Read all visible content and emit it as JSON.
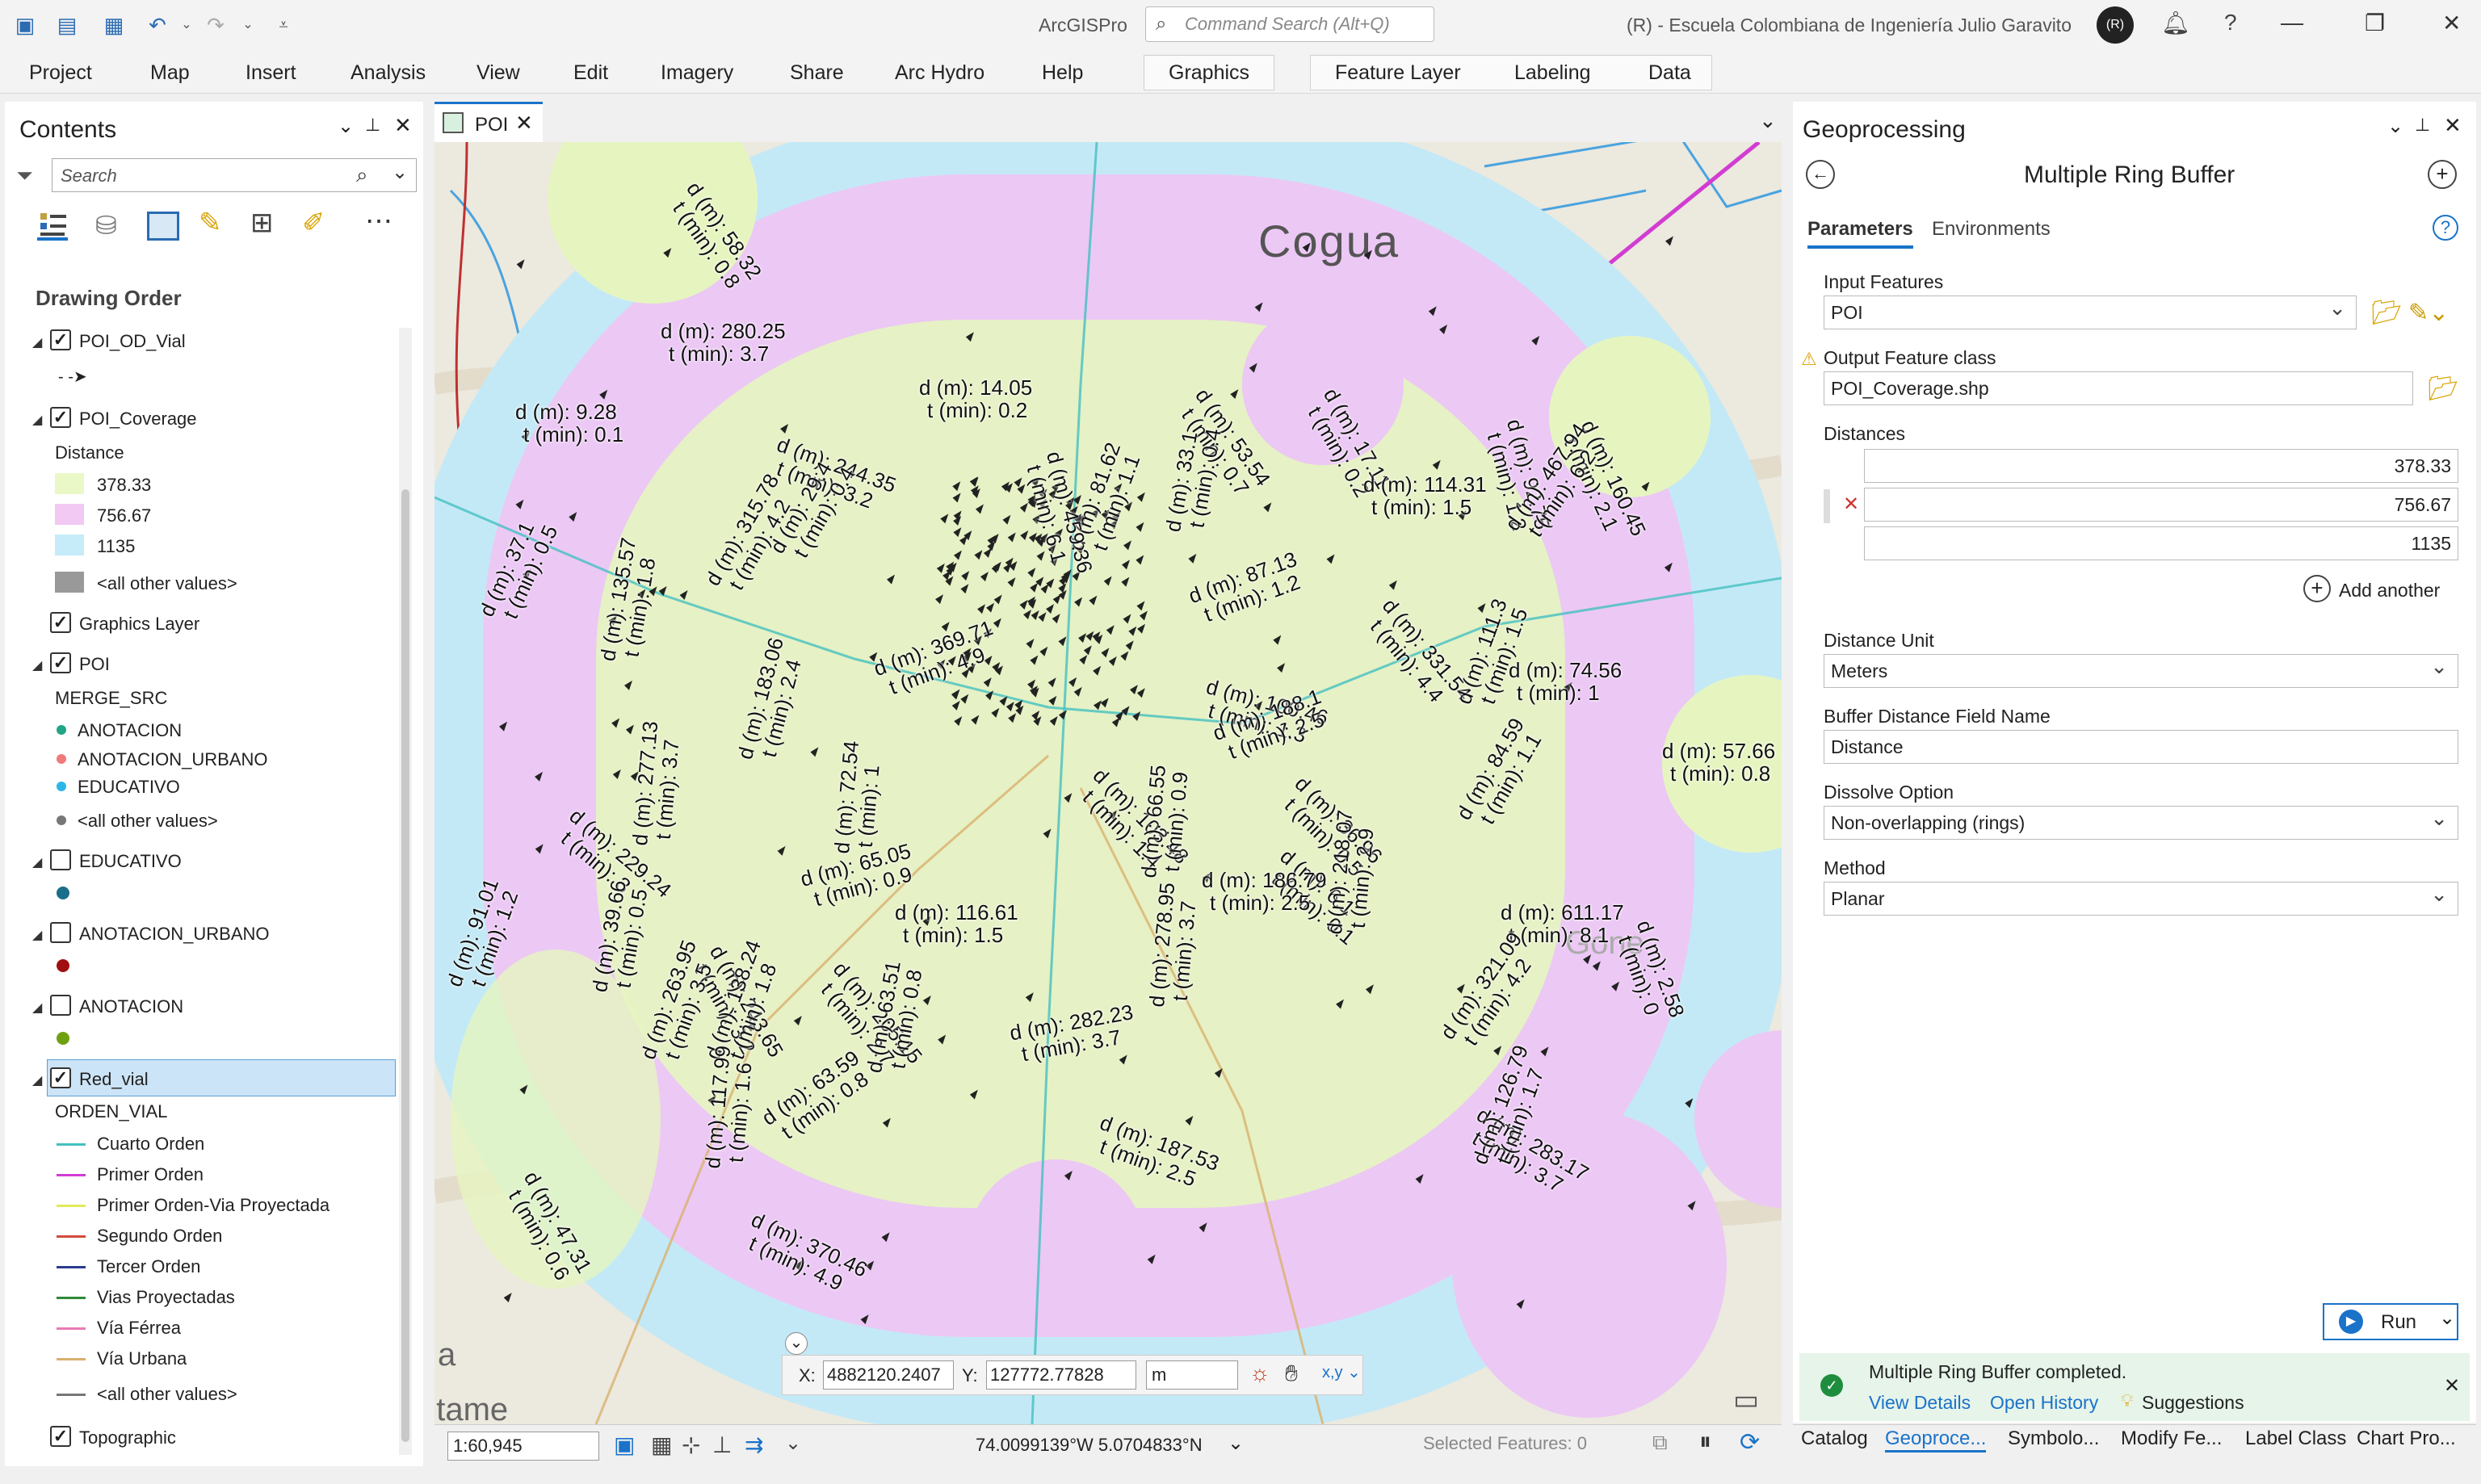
{
  "app": {
    "title": "ArcGISPro",
    "org": "(R) - Escuela Colombiana de Ingeniería Julio Garavito",
    "avatar": "(R)",
    "cmd_placeholder": "Command Search (Alt+Q)",
    "help": "?"
  },
  "ribbon": {
    "tabs": [
      "Project",
      "Map",
      "Insert",
      "Analysis",
      "View",
      "Edit",
      "Imagery",
      "Share",
      "Arc Hydro",
      "Help"
    ],
    "context_tabs": [
      "Graphics"
    ],
    "layer_tabs": [
      "Feature Layer",
      "Labeling",
      "Data"
    ]
  },
  "contents": {
    "title": "Contents",
    "search_placeholder": "Search",
    "drawing_order": "Drawing Order",
    "layers": {
      "od_vial": "POI_OD_Vial",
      "coverage": "POI_Coverage",
      "coverage_field": "Distance",
      "cov_vals": [
        "378.33",
        "756.67",
        "1135",
        "<all other values>"
      ],
      "graphics": "Graphics Layer",
      "poi": "POI",
      "poi_field": "MERGE_SRC",
      "poi_vals": [
        "ANOTACION",
        "ANOTACION_URBANO",
        "EDUCATIVO",
        "<all other values>"
      ],
      "educativo": "EDUCATIVO",
      "anot_urbano": "ANOTACION_URBANO",
      "anotacion": "ANOTACION",
      "red_vial": "Red_vial",
      "red_field": "ORDEN_VIAL",
      "red_vals": [
        "Cuarto Orden",
        "Primer Orden",
        "Primer Orden-Via Proyectada",
        "Segundo Orden",
        "Tercer Orden",
        "Vias Proyectadas",
        "Vía Férrea",
        "Vía Urbana",
        "<all other values>"
      ],
      "topo": "Topographic"
    }
  },
  "colors": {
    "ring1": "#e6f5c0",
    "ring2": "#ecc8f5",
    "ring3": "#c4e9f6",
    "selected": "#cce4f7",
    "accent": "#1a73c9",
    "cov1": "#eaf8c8",
    "cov2": "#f1c9f3",
    "cov3": "#c5ecf8",
    "poi": [
      "#22a487",
      "#f07a7a",
      "#2bb6e6",
      "#777777"
    ],
    "red": [
      "#43c1c1",
      "#d23cd2",
      "#e3ea5a",
      "#d24b3c",
      "#2a3b8f",
      "#2f8a3a",
      "#e87bb5",
      "#d9b16e",
      "#777777"
    ]
  },
  "map_tab": {
    "label": "POI"
  },
  "map": {
    "town": "Cogua",
    "gone": "Gone",
    "partial_left": "a",
    "partial_bottom": "ntame",
    "coords": {
      "x_label": "X:",
      "x_value": "4882120.2407",
      "y_label": "Y:",
      "y_value": "127772.77828",
      "unit": "m"
    },
    "scale": "1:60,945",
    "latlon": "74.0099139°W 5.0704833°N",
    "selected": "Selected Features: 0",
    "labels": [
      {
        "d": "d (m): 58.32",
        "t": "t (min): 0.8"
      },
      {
        "d": "d (m): 280.25",
        "t": "t (min): 3.7"
      },
      {
        "d": "d (m): 9.28",
        "t": "t (min): 0.1"
      },
      {
        "d": "d (m): 14.05",
        "t": "t (min): 0.2"
      },
      {
        "d": "d (m): 244.35",
        "t": "t (min): 3.2"
      },
      {
        "d": "d (m): 53.54",
        "t": "t (min): 0.7"
      },
      {
        "d": "d (m): 17.11",
        "t": "t (min): 0.2"
      },
      {
        "d": "d (m): 114.31",
        "t": "t (min): 1.5"
      },
      {
        "d": "d (m): 160.45",
        "t": "t (min): 2.1"
      },
      {
        "d": "d (m): 92.75",
        "t": "t (min): 1.2"
      },
      {
        "d": "d (m): 467.94",
        "t": "t (min): 6.2"
      },
      {
        "d": "d (m): 135.57",
        "t": "t (min): 1.8"
      },
      {
        "d": "d (m): 315.78",
        "t": "t (min): 4.2"
      },
      {
        "d": "d (m): 87.13",
        "t": "t (min): 1.2"
      },
      {
        "d": "d (m): 331.54",
        "t": "t (min): 4.4"
      },
      {
        "d": "d (m): 74.56",
        "t": "t (min): 1"
      },
      {
        "d": "d (m): 100.46",
        "t": "t (min): 1.3"
      },
      {
        "d": "d (m): 188.1",
        "t": "t (min): 2.5"
      },
      {
        "d": "d (m): 369.71",
        "t": "t (min): 4.9"
      },
      {
        "d": "d (m): 277.13",
        "t": "t (min): 3.7"
      },
      {
        "d": "d (m): 183.06",
        "t": "t (min): 2.4"
      },
      {
        "d": "d (m): 111.3",
        "t": "t (min): 1.5"
      },
      {
        "d": "d (m): 57.66",
        "t": "t (min): 0.8"
      },
      {
        "d": "d (m): 103.48",
        "t": "t (min): 1.4"
      },
      {
        "d": "d (m): 36.96",
        "t": "t (min): 0.5"
      },
      {
        "d": "d (m): 84.59",
        "t": "t (min): 1.1"
      },
      {
        "d": "d (m): 72.54",
        "t": "t (min): 1"
      },
      {
        "d": "d (m): 229.24",
        "t": "t (min): 3"
      },
      {
        "d": "d (m): 6.1",
        "t": "t (min): 0.1"
      },
      {
        "d": "d (m): 65.05",
        "t": "t (min): 0.9"
      },
      {
        "d": "d (m): 66.55",
        "t": "t (min): 0.9"
      },
      {
        "d": "d (m): 186.79",
        "t": "t (min): 2.5"
      },
      {
        "d": "d (m): 116.61",
        "t": "t (min): 1.5"
      },
      {
        "d": "d (m): 218.07",
        "t": "t (min): 2.9"
      },
      {
        "d": "d (m): 611.17",
        "t": "t (min): 8.1"
      },
      {
        "d": "d (m): 2.58",
        "t": "t (min): 0"
      },
      {
        "d": "d (m): 91.01",
        "t": "t (min): 1.2"
      },
      {
        "d": "d (m): 39.66",
        "t": "t (min): 0.5"
      },
      {
        "d": "d (m): 243.65",
        "t": "t (min): 3.2"
      },
      {
        "d": "d (m): 205.15",
        "t": "t (min): 2.7"
      },
      {
        "d": "d (m): 321.09",
        "t": "t (min): 4.2"
      },
      {
        "d": "d (m): 263.95",
        "t": "t (min): 3.5"
      },
      {
        "d": "d (m): 282.23",
        "t": "t (min): 3.7"
      },
      {
        "d": "d (m): 278.95",
        "t": "t (min): 3.7"
      },
      {
        "d": "d (m): 138.24",
        "t": "t (min): 1.8"
      },
      {
        "d": "d (m): 117.77",
        "t": "t (min): 1.6"
      },
      {
        "d": "d (m): 63.59",
        "t": "t (min): 0.8"
      },
      {
        "d": "d (m): 63.51",
        "t": "t (min): 0.8"
      },
      {
        "d": "d (m): 283.17",
        "t": "t (min): 3.7"
      },
      {
        "d": "d (m): 187.53",
        "t": "t (min): 2.5"
      },
      {
        "d": "d (m): 117.99",
        "t": "t (min): 1.6"
      },
      {
        "d": "d (m): 126.79",
        "t": "t (min): 1.7"
      },
      {
        "d": "d (m): 47.31",
        "t": "t (min): 0.6"
      },
      {
        "d": "d (m): 370.46",
        "t": "t (min): 4.9"
      },
      {
        "d": "d (m): 37.1",
        "t": "t (min): 0.5"
      },
      {
        "d": "d (m): 29.4",
        "t": "t (min): 0.4"
      },
      {
        "d": "d (m): 81.62",
        "t": "t (min): 1.1"
      },
      {
        "d": "d (m): 459.36",
        "t": "t (min): 6.1"
      },
      {
        "d": "d (m): 33.1",
        "t": "t (min): 0.4"
      }
    ]
  },
  "geo": {
    "title": "Geoprocessing",
    "tool": "Multiple Ring Buffer",
    "tab_params": "Parameters",
    "tab_env": "Environments",
    "input_label": "Input Features",
    "input_value": "POI",
    "output_label": "Output Feature class",
    "output_value": "POI_Coverage.shp",
    "dist_label": "Distances",
    "distances": [
      "378.33",
      "756.67",
      "1135"
    ],
    "add_another": "Add another",
    "unit_label": "Distance Unit",
    "unit_value": "Meters",
    "field_label": "Buffer Distance Field Name",
    "field_value": "Distance",
    "dissolve_label": "Dissolve Option",
    "dissolve_value": "Non-overlapping (rings)",
    "method_label": "Method",
    "method_value": "Planar",
    "run": "Run",
    "status": "Multiple Ring Buffer completed.",
    "view_details": "View Details",
    "open_history": "Open History",
    "suggestions": "Suggestions"
  },
  "bottom_tabs": [
    "Catalog",
    "Geoproce...",
    "Symbolo...",
    "Modify Fe...",
    "Label Class",
    "Chart Pro..."
  ]
}
